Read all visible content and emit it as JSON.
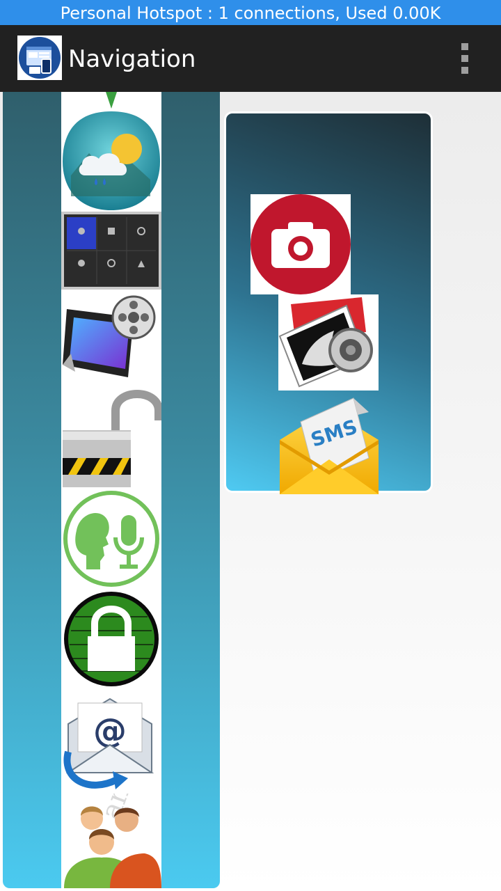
{
  "status_bar": {
    "text": "Personal Hotspot : 1 connections, Used 0.00K"
  },
  "app_bar": {
    "title": "Navigation",
    "icon": "app-logo-icon",
    "menu_icon": "overflow-menu-icon"
  },
  "left_menu": {
    "items": [
      {
        "icon": "weather-icon"
      },
      {
        "icon": "control-panel-icon"
      },
      {
        "icon": "video-player-icon"
      },
      {
        "icon": "unlock-icon"
      },
      {
        "icon": "voice-recognition-icon"
      },
      {
        "icon": "lock-icon"
      },
      {
        "icon": "email-icon"
      },
      {
        "icon": "contacts-icon"
      }
    ]
  },
  "right_menu": {
    "items": [
      {
        "icon": "camera-icon"
      },
      {
        "icon": "photo-viewer-icon"
      },
      {
        "icon": "sms-icon",
        "label": "SMS"
      }
    ]
  },
  "colors": {
    "status_bar": "#2f8fea",
    "app_bar": "#212121",
    "accent_red": "#c0172d",
    "green": "#72c15a"
  }
}
